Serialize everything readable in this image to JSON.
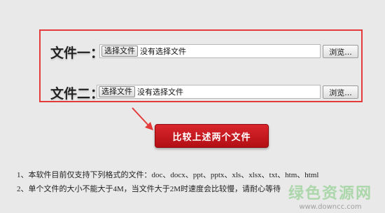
{
  "files": [
    {
      "label": "文件一：",
      "choose_label": "选择文件",
      "status": "没有选择文件",
      "browse_label": "浏览..."
    },
    {
      "label": "文件二：",
      "choose_label": "选择文件",
      "status": "没有选择文件",
      "browse_label": "浏览..."
    }
  ],
  "compare_button": "比较上述两个文件",
  "notes": [
    "1、本软件目前仅支持下列格式的文件：doc、docx、ppt、pptx、xls、xlsx、txt、htm、html",
    "2、单个文件的大小不能大于4M，当文件大于2M时速度会比较慢，请耐心等待"
  ],
  "watermark": {
    "text": "绿色资源网",
    "url": "www.downcc.com"
  },
  "colors": {
    "highlight_border": "#e53a3a",
    "button_red": "#c8171d",
    "watermark_green": "#78c878"
  }
}
